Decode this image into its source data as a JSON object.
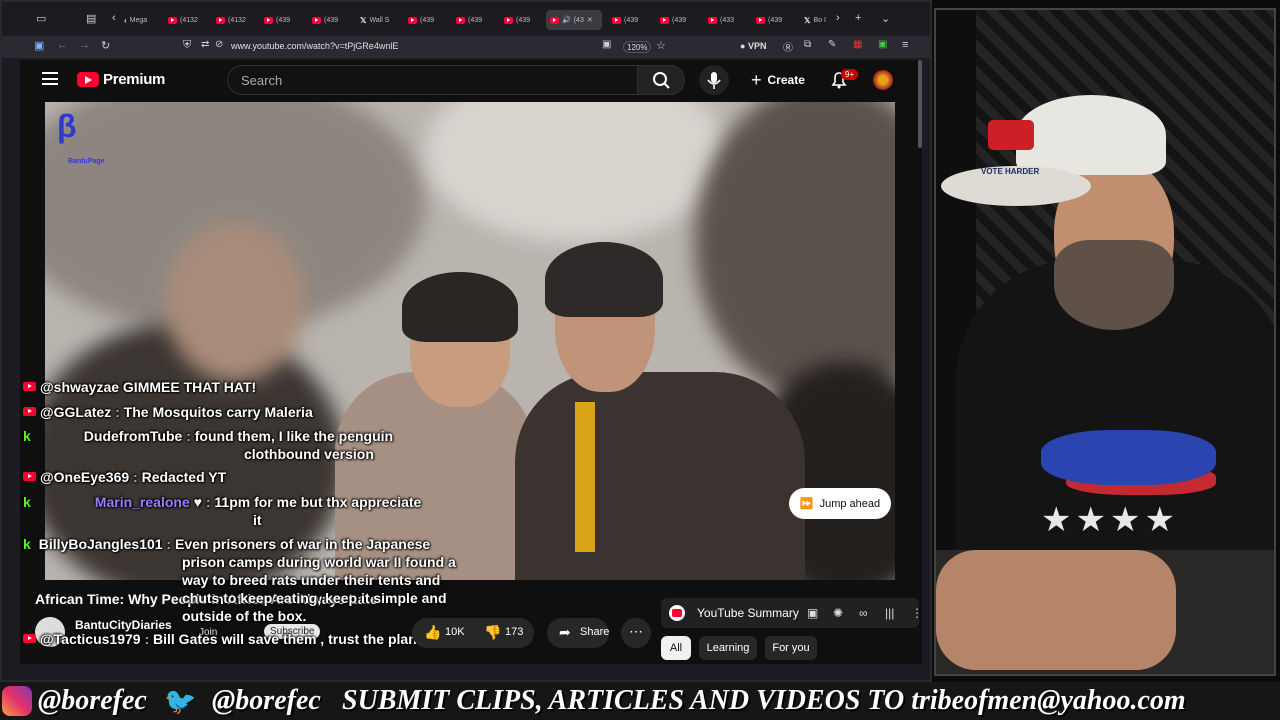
{
  "browser": {
    "tabs": [
      "",
      "",
      "Mega",
      "(4132",
      "(4132",
      "(439",
      "(439",
      "Wall S",
      "(439",
      "(439",
      "(439",
      "(43",
      "(439",
      "(439",
      "(433",
      "(439",
      "Bo I"
    ],
    "url": "www.youtube.com/watch?v=tPjGRe4wnlE",
    "zoom": "120%",
    "vpn": "VPN"
  },
  "youtube": {
    "brand": "Premium",
    "search_placeholder": "Search",
    "create_label": "Create",
    "notifications_badge": "9+",
    "jump_ahead": "Jump ahead",
    "video_title": "African Time: Why People in Africa Are Always Late",
    "channel": "BantuCityDiaries",
    "join_label": "Join",
    "subscribe_label": "Subscribe",
    "likes": "10K",
    "dislikes": "173",
    "share_label": "Share",
    "watermark": "BantuPage",
    "summary_title": "YouTube Summary",
    "chips": [
      "All",
      "Learning",
      "For you"
    ]
  },
  "chat": [
    {
      "platform": "yt",
      "user": "@shwayzae",
      "sep": "",
      "msg": "GIMMEE THAT HAT!"
    },
    {
      "platform": "yt",
      "user": "@GGLatez",
      "sep": ":",
      "msg": "The Mosquitos carry Maleria"
    },
    {
      "platform": "kick",
      "user": "DudefromTube",
      "sep": ":",
      "msg": "found them, I like the penguin",
      "msg2": "clothbound version"
    },
    {
      "platform": "yt",
      "user": "@OneEye369",
      "sep": ":",
      "msg": "Redacted YT"
    },
    {
      "platform": "kick",
      "user": "Marin_realone",
      "sep": ":",
      "msg": "11pm for me but thx appreciate",
      "msg2": "it"
    },
    {
      "platform": "kick",
      "user": "BillyBoJangles101",
      "sep": ":",
      "msg": "Even prisoners of war in the Japanese",
      "msg2": "prison camps during world war II found a",
      "msg3": "way to breed rats under their tents and",
      "msg4": "chuts to keep eating, keep it simple and",
      "msg5": "outside of the box."
    },
    {
      "platform": "yt",
      "user": "@Tacticus1979",
      "sep": ":",
      "msg": "Bill Gates will save them , trust the plan"
    }
  ],
  "webcam": {
    "hat_text": "VOTE HARDER"
  },
  "footer": {
    "instagram": "@borefec",
    "twitter": "@borefec",
    "submit_text": "SUBMIT CLIPS, ARTICLES AND VIDEOS TO tribeofmen@yahoo.com"
  },
  "colors": {
    "youtube_red": "#ff0033",
    "kick_green": "#53fc18",
    "chat_purple": "#9b7bff"
  }
}
